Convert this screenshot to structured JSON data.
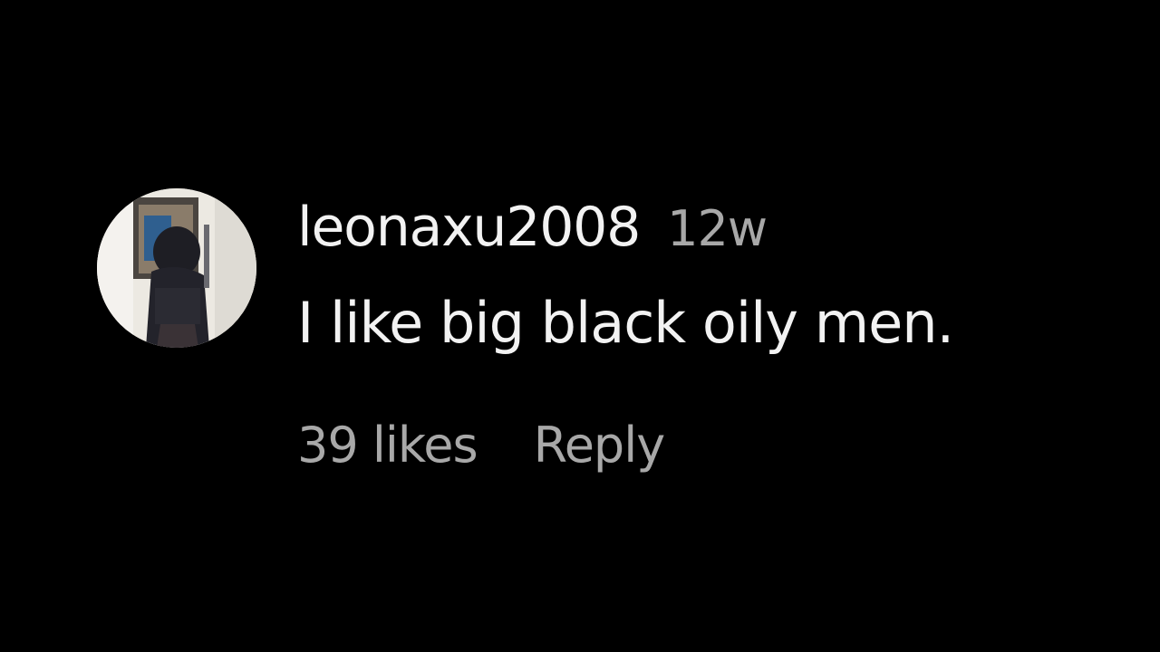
{
  "comment": {
    "username": "leonaxu2008",
    "timestamp": "12w",
    "text": "I like big black oily men.",
    "likes_label": "39 likes",
    "reply_label": "Reply",
    "avatar_icon": "user-avatar-photo"
  },
  "colors": {
    "background": "#000000",
    "primary_text": "#f2f2f2",
    "secondary_text": "#a8a8a8"
  }
}
